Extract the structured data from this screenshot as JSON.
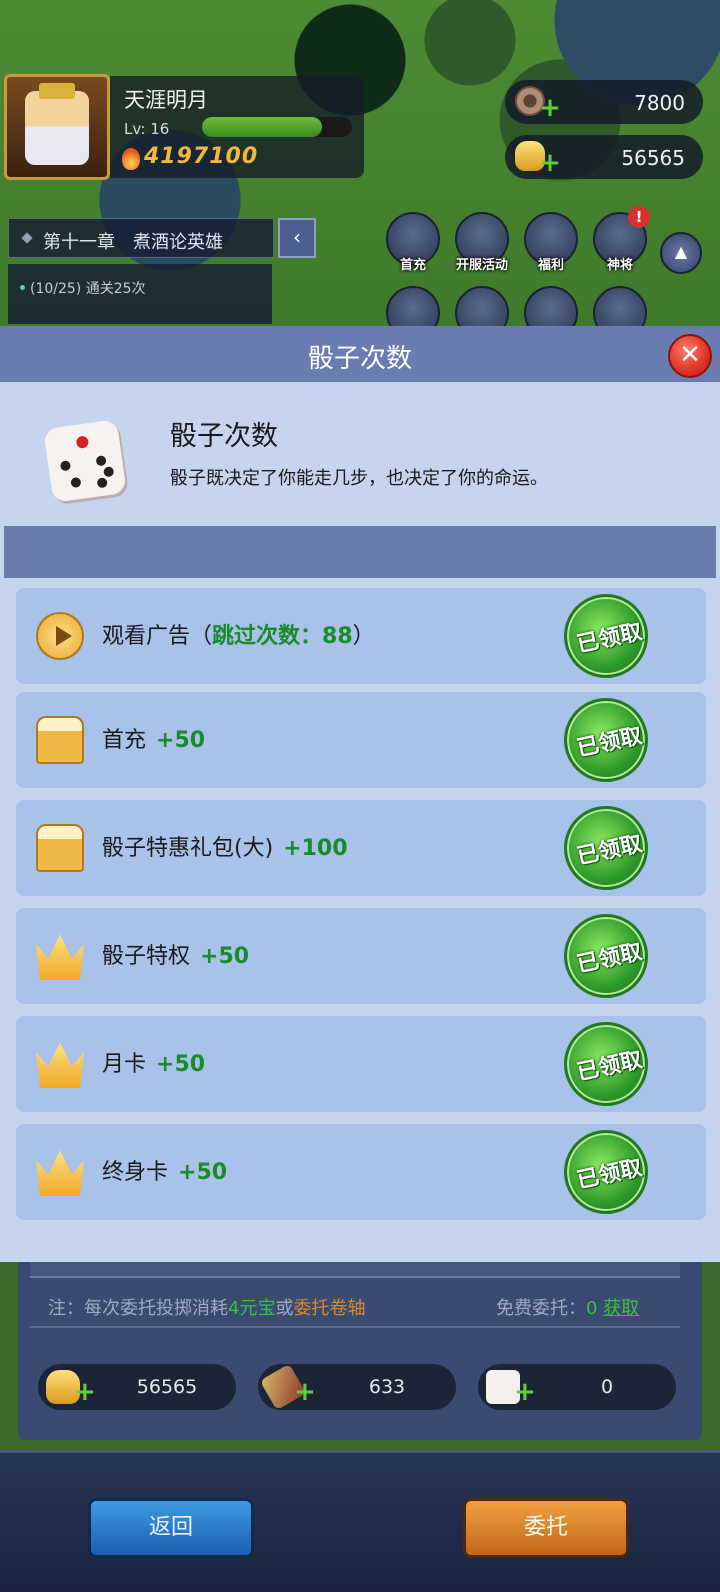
{
  "player": {
    "name": "天涯明月",
    "level": "Lv: 16",
    "xp_fraction": 0.8,
    "power": "4197100"
  },
  "resources": {
    "copper": "7800",
    "ingot": "56565"
  },
  "chapter": {
    "title": "第十一章　煮酒论英雄",
    "task": "(10/25) 通关25次"
  },
  "activity_icons": {
    "first_recharge": "首充",
    "server_event": "开服活动",
    "welfare": "福利",
    "divine_general": "神将",
    "badge": "!"
  },
  "dialog": {
    "title": "骰子次数",
    "close_symbol": "✕",
    "intro_title": "骰子次数",
    "intro_desc": "骰子既决定了你能走几步，也决定了你的命运。",
    "claimed_label": "已领取",
    "rows": [
      {
        "icon": "play-icon",
        "label": "观看广告（",
        "highlight": "跳过次数：88",
        "suffix": "）"
      },
      {
        "icon": "gift-icon",
        "label": "首充",
        "value": "+50"
      },
      {
        "icon": "gift-icon",
        "label": "骰子特惠礼包(大)",
        "value": "+100"
      },
      {
        "icon": "crown-icon",
        "label": "骰子特权",
        "value": "+50"
      },
      {
        "icon": "crown-icon",
        "label": "月卡",
        "value": "+50"
      },
      {
        "icon": "crown-icon",
        "label": "终身卡",
        "value": "+50"
      }
    ]
  },
  "underlying": {
    "note_prefix": "注：每次委托投掷消耗",
    "note_cost": "4元宝",
    "note_or": "或",
    "note_item": "委托卷轴",
    "free_label": "免费委托：",
    "free_count": "0",
    "free_link": "获取",
    "ingots": "56565",
    "scrolls": "633",
    "dice": "0",
    "back_button": "返回",
    "entrust_button": "委托"
  }
}
